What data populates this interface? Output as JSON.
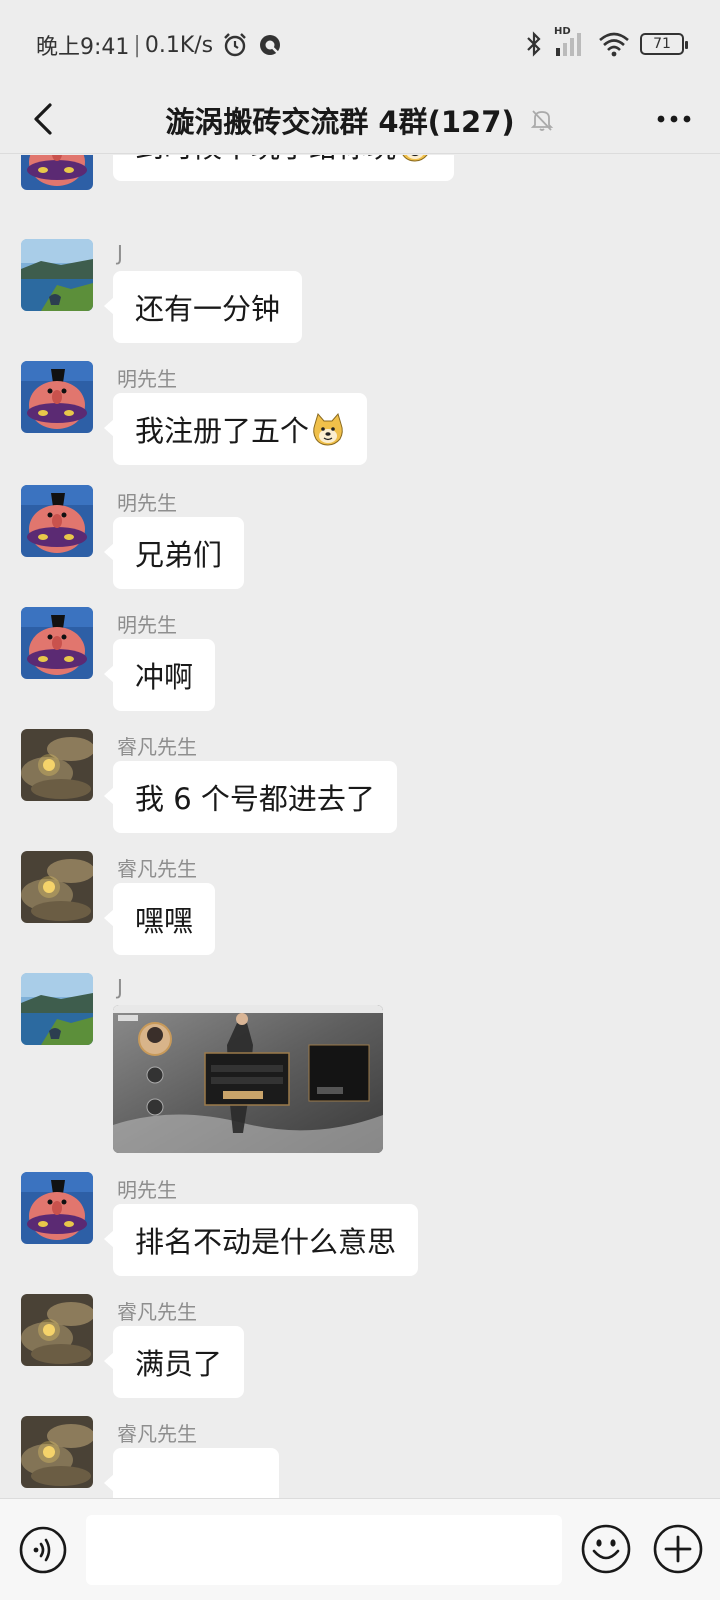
{
  "status_bar": {
    "time": "晚上9:41",
    "separator": "|",
    "network_speed": "0.1K/s",
    "network_type": "HD",
    "battery": "71",
    "icons": [
      "alarm-icon",
      "q-app-icon",
      "bluetooth-icon",
      "signal-icon",
      "wifi-icon",
      "battery-icon"
    ]
  },
  "header": {
    "title": "漩涡搬砖交流群 4群(127)",
    "icons": [
      "back-arrow-icon",
      "mute-bell-icon",
      "more-dots-icon"
    ]
  },
  "messages": [
    {
      "sender": "",
      "text": "到时候不玩了给你玩",
      "emoji": "doge-emoji",
      "avatar": "cartoon-avatar"
    },
    {
      "sender": "J",
      "text": "还有一分钟",
      "avatar": "landscape-avatar"
    },
    {
      "sender": "明先生",
      "text": "我注册了五个",
      "emoji": "doge-emoji",
      "avatar": "cartoon-avatar"
    },
    {
      "sender": "明先生",
      "text": "兄弟们",
      "avatar": "cartoon-avatar"
    },
    {
      "sender": "明先生",
      "text": "冲啊",
      "avatar": "cartoon-avatar"
    },
    {
      "sender": "睿凡先生",
      "text": "我 6 个号都进去了",
      "avatar": "moon-avatar"
    },
    {
      "sender": "睿凡先生",
      "text": "嘿嘿",
      "avatar": "moon-avatar"
    },
    {
      "sender": "J",
      "text": "",
      "image": "game-screenshot",
      "avatar": "landscape-avatar"
    },
    {
      "sender": "明先生",
      "text": "排名不动是什么意思",
      "avatar": "cartoon-avatar"
    },
    {
      "sender": "睿凡先生",
      "text": "满员了",
      "avatar": "moon-avatar"
    },
    {
      "sender": "睿凡先生",
      "text": "",
      "avatar": "moon-avatar"
    }
  ],
  "input_bar": {
    "placeholder": "",
    "value": "",
    "icons": [
      "voice-icon",
      "emoji-icon",
      "plus-icon"
    ]
  },
  "colors": {
    "background": "#ededed",
    "bubble": "#ffffff",
    "sender_name": "#8e8e8e",
    "input_bar": "#f7f7f7"
  }
}
